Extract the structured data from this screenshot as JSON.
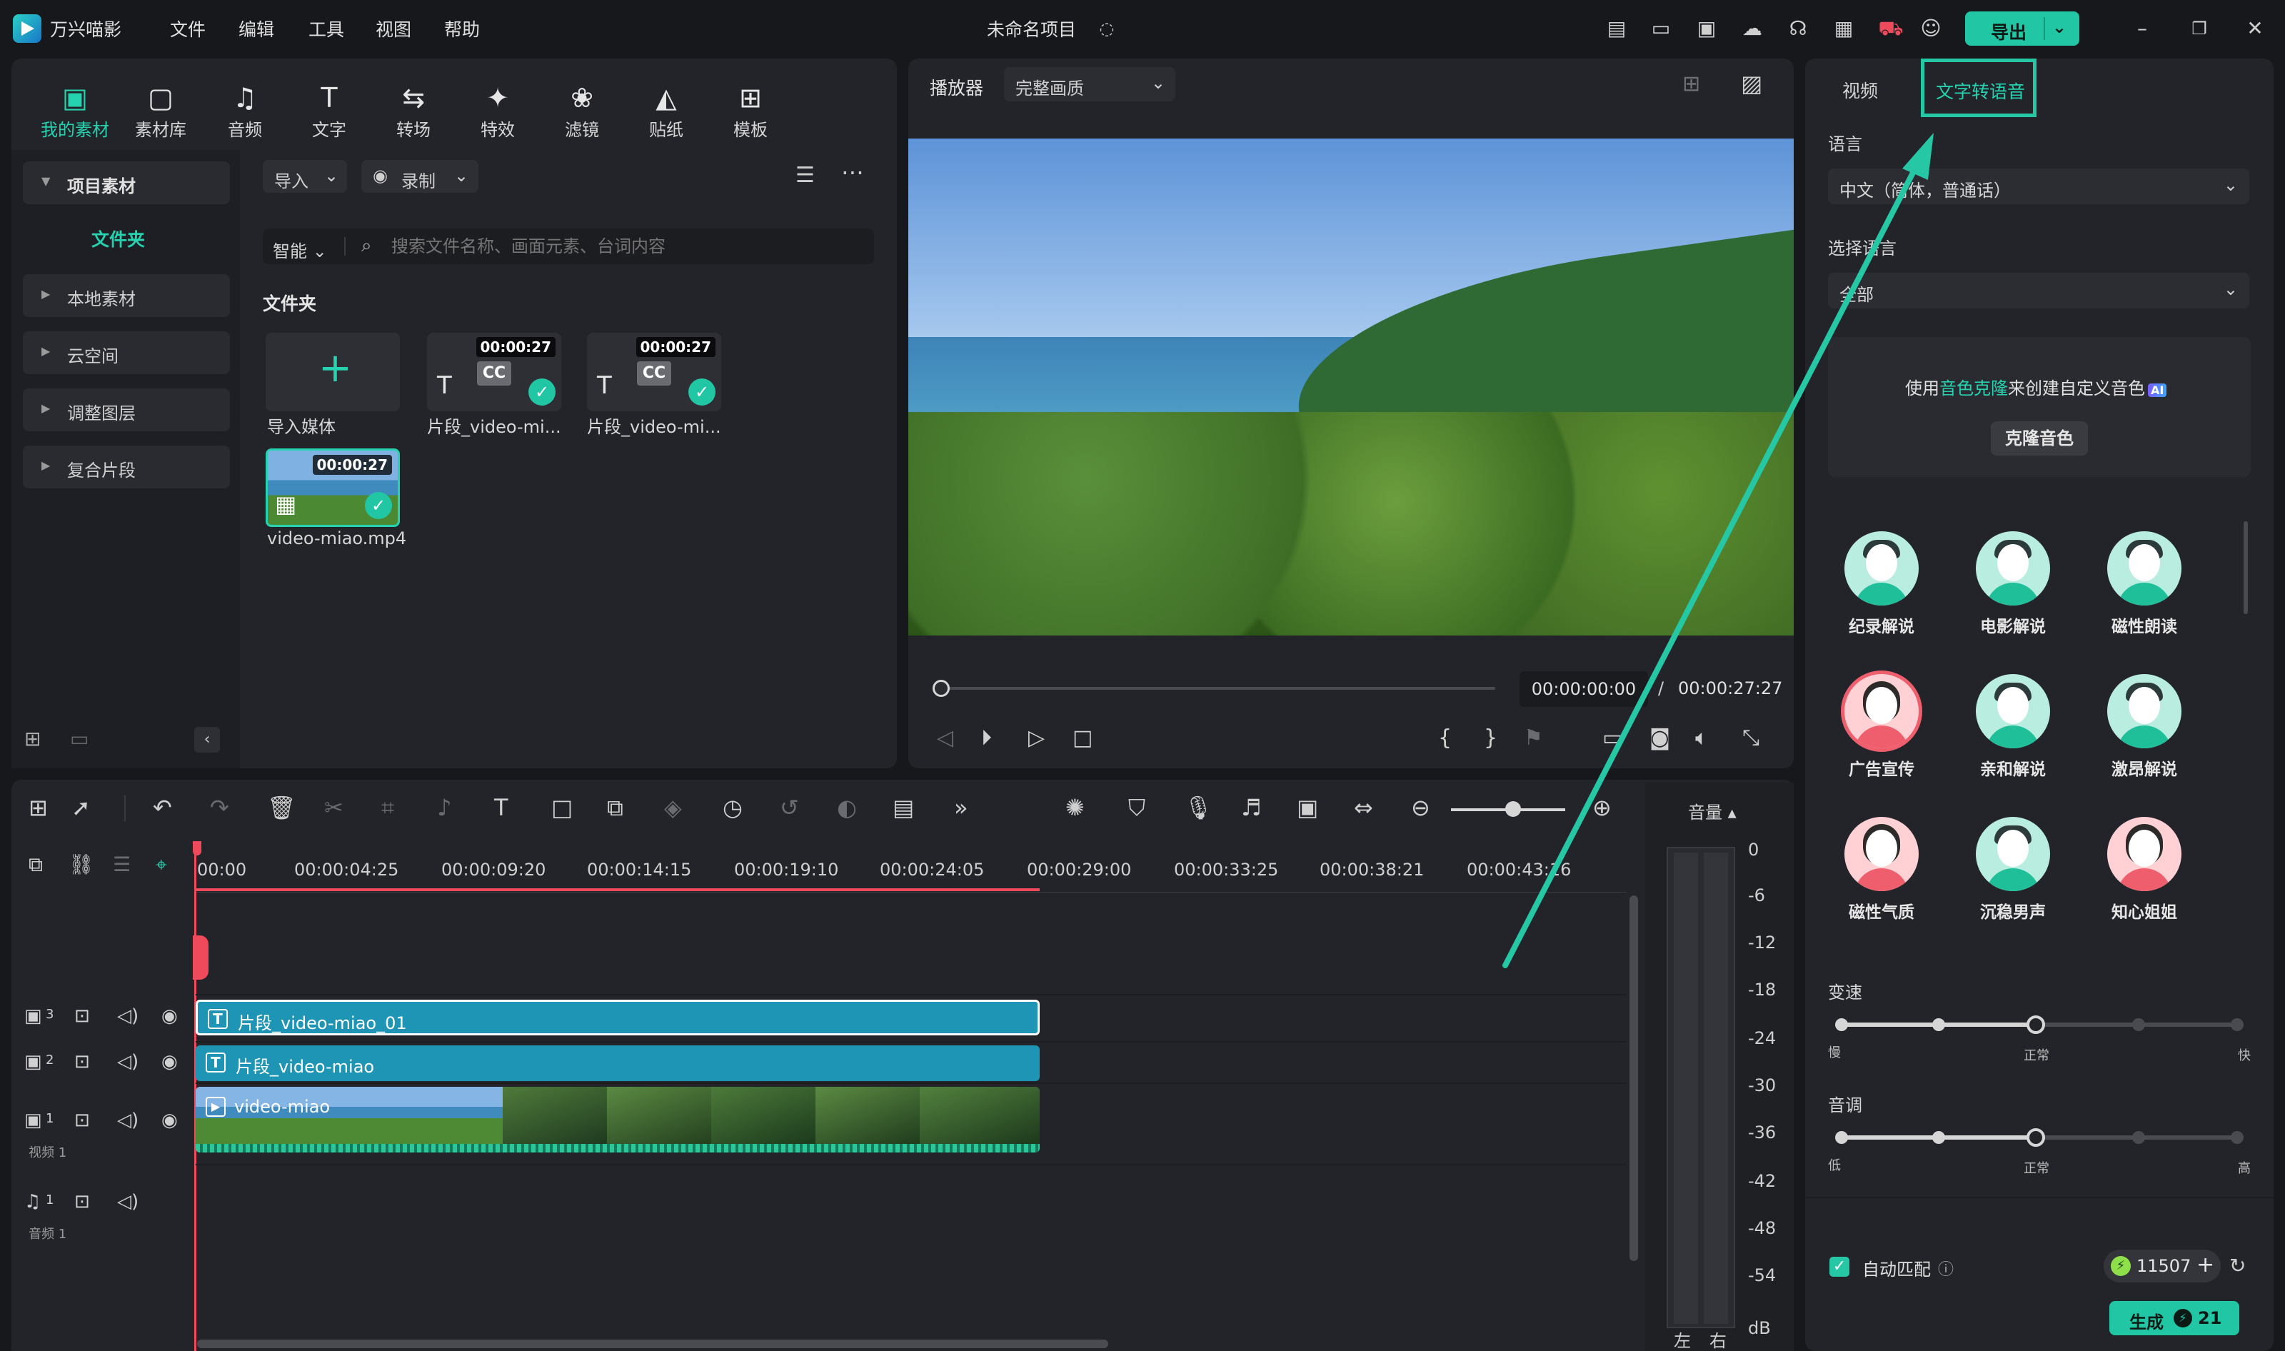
{
  "titlebar": {
    "app_name": "万兴喵影",
    "menu": [
      "文件",
      "编辑",
      "工具",
      "视图",
      "帮助"
    ],
    "project_title": "未命名项目",
    "export_label": "导出"
  },
  "library": {
    "tabs": [
      {
        "label": "我的素材",
        "icon": "media-icon"
      },
      {
        "label": "素材库",
        "icon": "stock-icon"
      },
      {
        "label": "音频",
        "icon": "music-icon"
      },
      {
        "label": "文字",
        "icon": "text-icon"
      },
      {
        "label": "转场",
        "icon": "transition-icon"
      },
      {
        "label": "特效",
        "icon": "effects-icon"
      },
      {
        "label": "滤镜",
        "icon": "filter-icon"
      },
      {
        "label": "贴纸",
        "icon": "sticker-icon"
      },
      {
        "label": "模板",
        "icon": "template-icon"
      }
    ],
    "sidebar": {
      "project_media": "项目素材",
      "folder": "文件夹",
      "items": [
        "本地素材",
        "云空间",
        "调整图层",
        "复合片段"
      ]
    },
    "import_label": "导入",
    "record_label": "录制",
    "smart_label": "智能",
    "search_placeholder": "搜索文件名称、画面元素、台词内容",
    "folder_heading": "文件夹",
    "media": [
      {
        "label": "导入媒体"
      },
      {
        "label": "片段_video-mi...",
        "duration": "00:00:27"
      },
      {
        "label": "片段_video-mi...",
        "duration": "00:00:27"
      },
      {
        "label": "video-miao.mp4",
        "duration": "00:00:27"
      }
    ]
  },
  "player": {
    "label": "播放器",
    "quality": "完整画质",
    "current_time": "00:00:00:00",
    "separator": "/",
    "total_time": "00:00:27:27"
  },
  "tts": {
    "tab_video": "视频",
    "tab_tts": "文字转语音",
    "language_label": "语言",
    "language_value": "中文（简体，普通话）",
    "voice_lang_label": "选择语言",
    "voice_lang_value": "全部",
    "clone_text_pre": "使用",
    "clone_text_link": "音色克隆",
    "clone_text_post": "来创建自定义音色",
    "ai_badge": "AI",
    "clone_button": "克隆音色",
    "voices": [
      {
        "name": "纪录解说",
        "gender": "m"
      },
      {
        "name": "电影解说",
        "gender": "m"
      },
      {
        "name": "磁性朗读",
        "gender": "m"
      },
      {
        "name": "广告宣传",
        "gender": "f"
      },
      {
        "name": "亲和解说",
        "gender": "m"
      },
      {
        "name": "激昂解说",
        "gender": "m"
      },
      {
        "name": "磁性气质",
        "gender": "f"
      },
      {
        "name": "沉稳男声",
        "gender": "m"
      },
      {
        "name": "知心姐姐",
        "gender": "f"
      }
    ],
    "speed_label": "变速",
    "speed_marks": [
      "慢",
      "正常",
      "快"
    ],
    "pitch_label": "音调",
    "pitch_marks": [
      "低",
      "正常",
      "高"
    ],
    "auto_match_label": "自动匹配",
    "credits": "11507",
    "generate_label": "生成",
    "generate_cost": "21"
  },
  "timeline": {
    "ruler": [
      "00:00",
      "00:00:04:25",
      "00:00:09:20",
      "00:00:14:15",
      "00:00:19:10",
      "00:00:24:05",
      "00:00:29:00",
      "00:00:33:25",
      "00:00:38:21",
      "00:00:43:16"
    ],
    "tracks": [
      {
        "num": "3"
      },
      {
        "num": "2"
      },
      {
        "num": "1",
        "name": "视频 1"
      },
      {
        "num": "1",
        "name": "音频 1"
      }
    ],
    "clips": [
      "片段_video-miao_01",
      "片段_video-miao",
      "video-miao"
    ],
    "meter_title": "音量",
    "meter_scale": [
      "0",
      "-6",
      "-12",
      "-18",
      "-24",
      "-30",
      "-36",
      "-42",
      "-48",
      "-54",
      "dB"
    ],
    "meter_left": "左",
    "meter_right": "右"
  }
}
